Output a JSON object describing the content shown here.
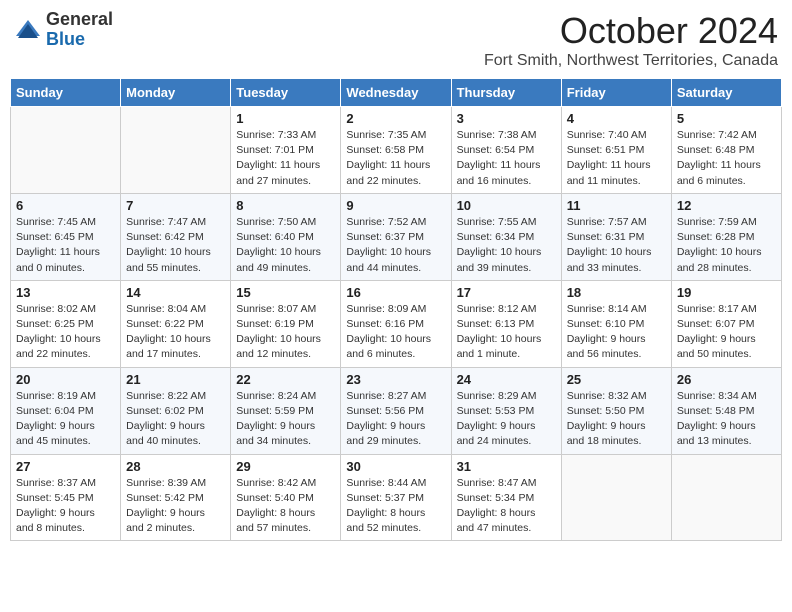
{
  "header": {
    "logo_general": "General",
    "logo_blue": "Blue",
    "month_title": "October 2024",
    "location": "Fort Smith, Northwest Territories, Canada"
  },
  "weekdays": [
    "Sunday",
    "Monday",
    "Tuesday",
    "Wednesday",
    "Thursday",
    "Friday",
    "Saturday"
  ],
  "weeks": [
    [
      {
        "day": "",
        "sunrise": "",
        "sunset": "",
        "daylight": ""
      },
      {
        "day": "",
        "sunrise": "",
        "sunset": "",
        "daylight": ""
      },
      {
        "day": "1",
        "sunrise": "Sunrise: 7:33 AM",
        "sunset": "Sunset: 7:01 PM",
        "daylight": "Daylight: 11 hours and 27 minutes."
      },
      {
        "day": "2",
        "sunrise": "Sunrise: 7:35 AM",
        "sunset": "Sunset: 6:58 PM",
        "daylight": "Daylight: 11 hours and 22 minutes."
      },
      {
        "day": "3",
        "sunrise": "Sunrise: 7:38 AM",
        "sunset": "Sunset: 6:54 PM",
        "daylight": "Daylight: 11 hours and 16 minutes."
      },
      {
        "day": "4",
        "sunrise": "Sunrise: 7:40 AM",
        "sunset": "Sunset: 6:51 PM",
        "daylight": "Daylight: 11 hours and 11 minutes."
      },
      {
        "day": "5",
        "sunrise": "Sunrise: 7:42 AM",
        "sunset": "Sunset: 6:48 PM",
        "daylight": "Daylight: 11 hours and 6 minutes."
      }
    ],
    [
      {
        "day": "6",
        "sunrise": "Sunrise: 7:45 AM",
        "sunset": "Sunset: 6:45 PM",
        "daylight": "Daylight: 11 hours and 0 minutes."
      },
      {
        "day": "7",
        "sunrise": "Sunrise: 7:47 AM",
        "sunset": "Sunset: 6:42 PM",
        "daylight": "Daylight: 10 hours and 55 minutes."
      },
      {
        "day": "8",
        "sunrise": "Sunrise: 7:50 AM",
        "sunset": "Sunset: 6:40 PM",
        "daylight": "Daylight: 10 hours and 49 minutes."
      },
      {
        "day": "9",
        "sunrise": "Sunrise: 7:52 AM",
        "sunset": "Sunset: 6:37 PM",
        "daylight": "Daylight: 10 hours and 44 minutes."
      },
      {
        "day": "10",
        "sunrise": "Sunrise: 7:55 AM",
        "sunset": "Sunset: 6:34 PM",
        "daylight": "Daylight: 10 hours and 39 minutes."
      },
      {
        "day": "11",
        "sunrise": "Sunrise: 7:57 AM",
        "sunset": "Sunset: 6:31 PM",
        "daylight": "Daylight: 10 hours and 33 minutes."
      },
      {
        "day": "12",
        "sunrise": "Sunrise: 7:59 AM",
        "sunset": "Sunset: 6:28 PM",
        "daylight": "Daylight: 10 hours and 28 minutes."
      }
    ],
    [
      {
        "day": "13",
        "sunrise": "Sunrise: 8:02 AM",
        "sunset": "Sunset: 6:25 PM",
        "daylight": "Daylight: 10 hours and 22 minutes."
      },
      {
        "day": "14",
        "sunrise": "Sunrise: 8:04 AM",
        "sunset": "Sunset: 6:22 PM",
        "daylight": "Daylight: 10 hours and 17 minutes."
      },
      {
        "day": "15",
        "sunrise": "Sunrise: 8:07 AM",
        "sunset": "Sunset: 6:19 PM",
        "daylight": "Daylight: 10 hours and 12 minutes."
      },
      {
        "day": "16",
        "sunrise": "Sunrise: 8:09 AM",
        "sunset": "Sunset: 6:16 PM",
        "daylight": "Daylight: 10 hours and 6 minutes."
      },
      {
        "day": "17",
        "sunrise": "Sunrise: 8:12 AM",
        "sunset": "Sunset: 6:13 PM",
        "daylight": "Daylight: 10 hours and 1 minute."
      },
      {
        "day": "18",
        "sunrise": "Sunrise: 8:14 AM",
        "sunset": "Sunset: 6:10 PM",
        "daylight": "Daylight: 9 hours and 56 minutes."
      },
      {
        "day": "19",
        "sunrise": "Sunrise: 8:17 AM",
        "sunset": "Sunset: 6:07 PM",
        "daylight": "Daylight: 9 hours and 50 minutes."
      }
    ],
    [
      {
        "day": "20",
        "sunrise": "Sunrise: 8:19 AM",
        "sunset": "Sunset: 6:04 PM",
        "daylight": "Daylight: 9 hours and 45 minutes."
      },
      {
        "day": "21",
        "sunrise": "Sunrise: 8:22 AM",
        "sunset": "Sunset: 6:02 PM",
        "daylight": "Daylight: 9 hours and 40 minutes."
      },
      {
        "day": "22",
        "sunrise": "Sunrise: 8:24 AM",
        "sunset": "Sunset: 5:59 PM",
        "daylight": "Daylight: 9 hours and 34 minutes."
      },
      {
        "day": "23",
        "sunrise": "Sunrise: 8:27 AM",
        "sunset": "Sunset: 5:56 PM",
        "daylight": "Daylight: 9 hours and 29 minutes."
      },
      {
        "day": "24",
        "sunrise": "Sunrise: 8:29 AM",
        "sunset": "Sunset: 5:53 PM",
        "daylight": "Daylight: 9 hours and 24 minutes."
      },
      {
        "day": "25",
        "sunrise": "Sunrise: 8:32 AM",
        "sunset": "Sunset: 5:50 PM",
        "daylight": "Daylight: 9 hours and 18 minutes."
      },
      {
        "day": "26",
        "sunrise": "Sunrise: 8:34 AM",
        "sunset": "Sunset: 5:48 PM",
        "daylight": "Daylight: 9 hours and 13 minutes."
      }
    ],
    [
      {
        "day": "27",
        "sunrise": "Sunrise: 8:37 AM",
        "sunset": "Sunset: 5:45 PM",
        "daylight": "Daylight: 9 hours and 8 minutes."
      },
      {
        "day": "28",
        "sunrise": "Sunrise: 8:39 AM",
        "sunset": "Sunset: 5:42 PM",
        "daylight": "Daylight: 9 hours and 2 minutes."
      },
      {
        "day": "29",
        "sunrise": "Sunrise: 8:42 AM",
        "sunset": "Sunset: 5:40 PM",
        "daylight": "Daylight: 8 hours and 57 minutes."
      },
      {
        "day": "30",
        "sunrise": "Sunrise: 8:44 AM",
        "sunset": "Sunset: 5:37 PM",
        "daylight": "Daylight: 8 hours and 52 minutes."
      },
      {
        "day": "31",
        "sunrise": "Sunrise: 8:47 AM",
        "sunset": "Sunset: 5:34 PM",
        "daylight": "Daylight: 8 hours and 47 minutes."
      },
      {
        "day": "",
        "sunrise": "",
        "sunset": "",
        "daylight": ""
      },
      {
        "day": "",
        "sunrise": "",
        "sunset": "",
        "daylight": ""
      }
    ]
  ]
}
